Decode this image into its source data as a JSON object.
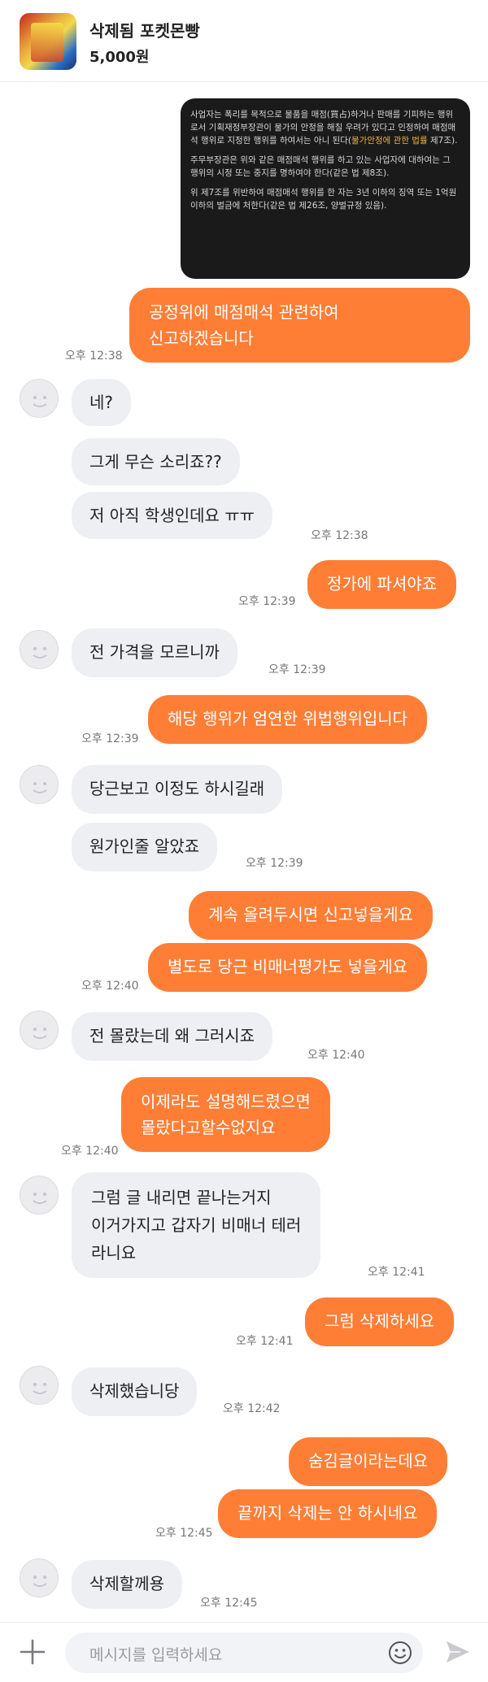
{
  "header": {
    "title": "삭제됨 포켓몬빵",
    "price": "5,000원"
  },
  "notice": {
    "p1_a": "사업자는 폭리를 목적으로 물품을 매점(買占)하거나 판매를 기피하는 행위로서 기획재정부장관이 물가의 안정을 해칠 우려가 있다고 인정하여 매점매석 행위로 지정한 행위를 하여서는 아니 된다(",
    "p1_hl": "물가안정에 관한 법률",
    "p1_b": " 제7조).",
    "p2": "주무부장관은 위와 같은 매점매석 행위를 하고 있는 사업자에 대하여는 그 행위의 시정 또는 중지를 명하여야 한다(같은 법 제8조).",
    "p3": "위 제7조를 위반하여 매점매석 행위를 한 자는 3년 이하의 징역 또는 1억원 이하의 벌금에 처한다(같은 법 제26조, 양벌규정 있음)."
  },
  "messages": [
    {
      "text": "공정위에 매점매석 관련하여\n신고하겠습니다"
    },
    {
      "text": "네?"
    },
    {
      "text": "그게 무슨 소리죠??"
    },
    {
      "text": "저 아직 학생인데요 ㅠㅠ"
    },
    {
      "text": "정가에 파셔야죠"
    },
    {
      "text": "전 가격을 모르니까"
    },
    {
      "text": "해당 행위가 엄연한 위법행위입니다"
    },
    {
      "text": "당근보고 이정도 하시길래"
    },
    {
      "text": "원가인줄 알았죠"
    },
    {
      "text": "계속 올려두시면 신고넣을게요"
    },
    {
      "text": "별도로 당근 비매너평가도 넣을게요"
    },
    {
      "text": "전 몰랐는데 왜 그러시죠"
    },
    {
      "text": "이제라도 설명해드렸으면\n몰랐다고할수없지요"
    },
    {
      "text": "그럼 글 내리면 끝나는거지\n이거가지고 갑자기 비매너 테러\n라니요"
    },
    {
      "text": "그럼 삭제하세요"
    },
    {
      "text": "삭제했습니당"
    },
    {
      "text": "숨김글이라는데요"
    },
    {
      "text": "끝까지 삭제는 안 하시네요"
    },
    {
      "text": "삭제할께용"
    }
  ],
  "times": {
    "t1238": "오후 12:38",
    "t1239": "오후 12:39",
    "t1240": "오후 12:40",
    "t1241": "오후 12:41",
    "t1242": "오후 12:42",
    "t1245": "오후 12:45"
  },
  "input": {
    "placeholder": "메시지를 입력하세요"
  },
  "colors": {
    "accent": "#ff7e36",
    "incoming_bubble": "#eeeff3"
  },
  "icons": [
    "plus-icon",
    "emoji-icon",
    "send-icon",
    "avatar-icon"
  ]
}
